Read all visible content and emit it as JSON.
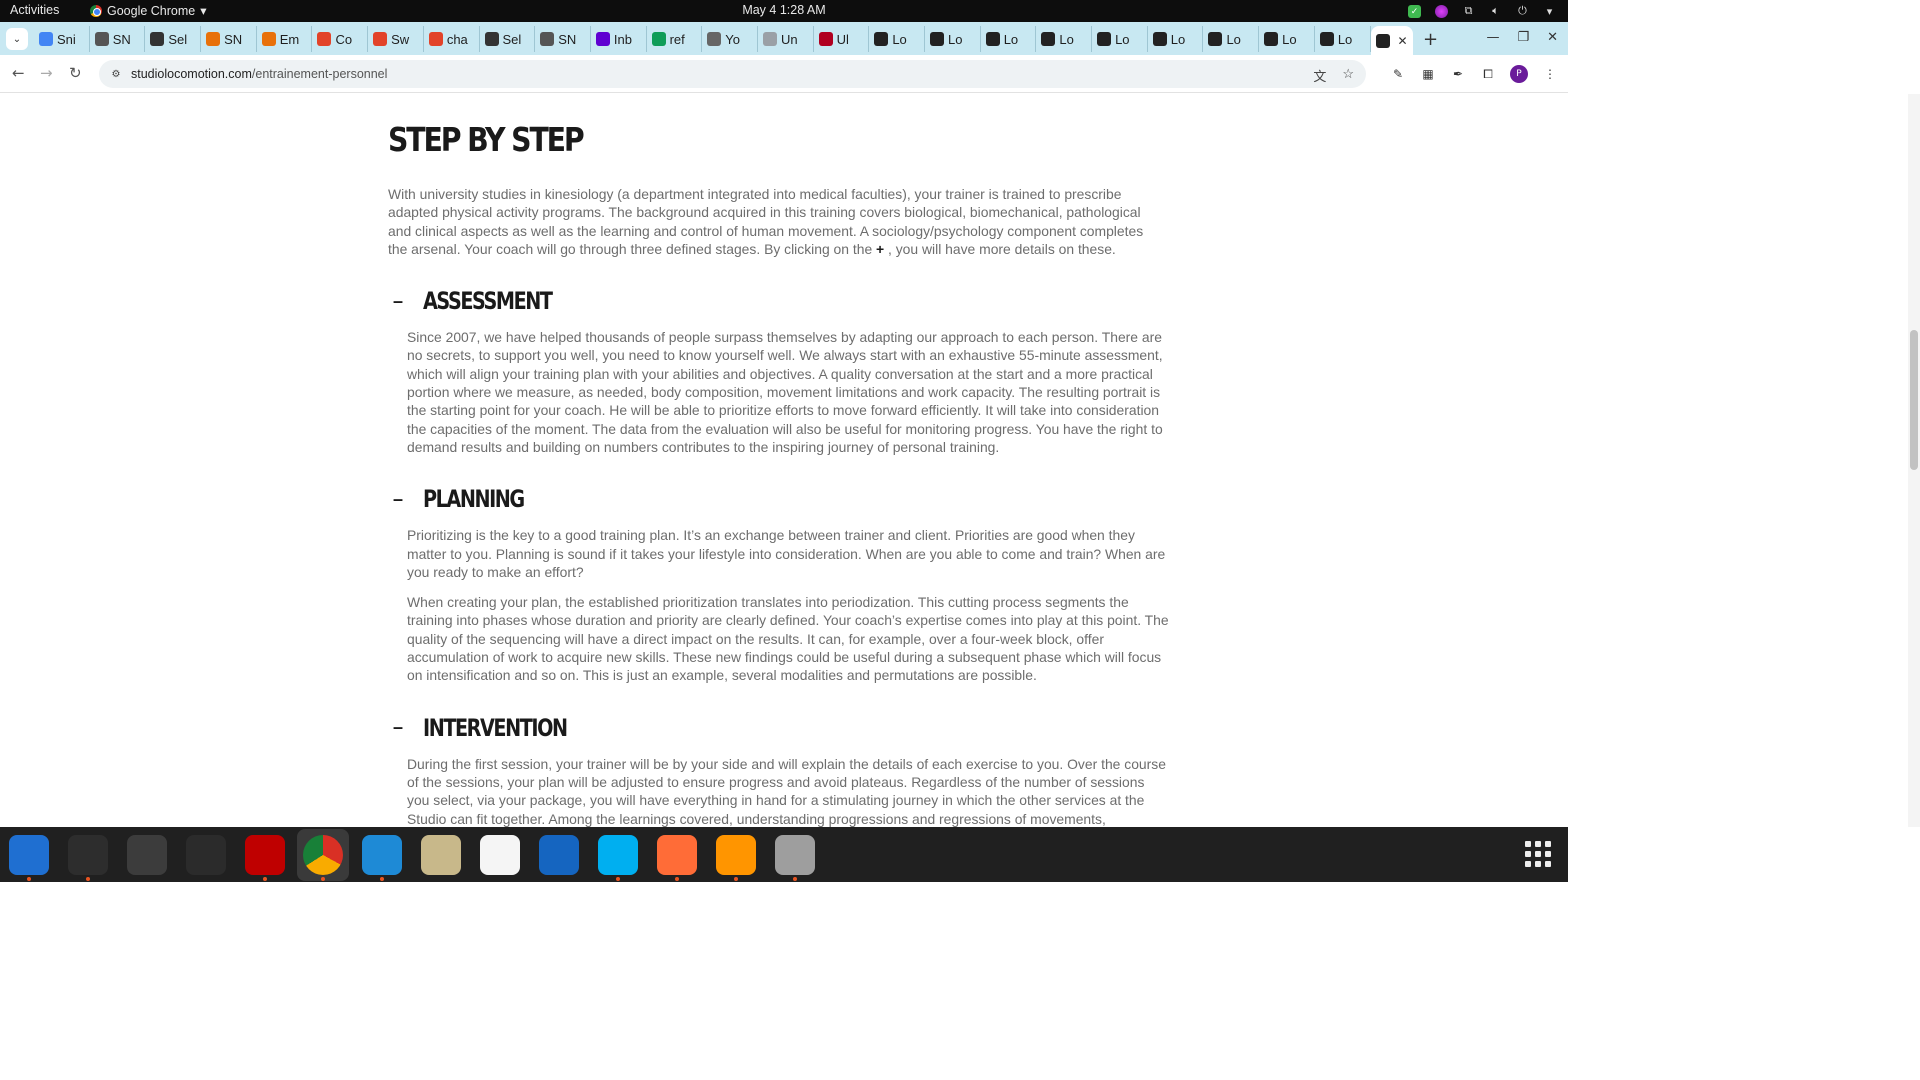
{
  "system": {
    "activities": "Activities",
    "app_name": "Google Chrome",
    "clock": "May 4  1:28 AM"
  },
  "tabs": [
    {
      "label": "Sni",
      "icon": "docs-icon",
      "color": "#4285f4"
    },
    {
      "label": "SN",
      "icon": "snp-icon",
      "color": "#555555"
    },
    {
      "label": "Sel",
      "icon": "circle-icon",
      "color": "#333333"
    },
    {
      "label": "SN",
      "icon": "emoji-icon",
      "color": "#e8710a"
    },
    {
      "label": "Em",
      "icon": "emoji-icon",
      "color": "#e8710a"
    },
    {
      "label": "Co",
      "icon": "gitlab-icon",
      "color": "#e24329"
    },
    {
      "label": "Sw",
      "icon": "gitlab-icon",
      "color": "#e24329"
    },
    {
      "label": "cha",
      "icon": "gitlab-icon",
      "color": "#e24329"
    },
    {
      "label": "Sel",
      "icon": "circle-icon",
      "color": "#333333"
    },
    {
      "label": "SN",
      "icon": "snp-icon",
      "color": "#555555"
    },
    {
      "label": "Inb",
      "icon": "yahoo-icon",
      "color": "#5f01d1"
    },
    {
      "label": "ref",
      "icon": "sheets-icon",
      "color": "#0f9d58"
    },
    {
      "label": "Yo",
      "icon": "spiral-icon",
      "color": "#666666"
    },
    {
      "label": "Un",
      "icon": "page-icon",
      "color": "#9aa0a6"
    },
    {
      "label": "Ul",
      "icon": "flag-icon",
      "color": "#b00020"
    },
    {
      "label": "Lo",
      "icon": "loco-icon",
      "color": "#222222"
    },
    {
      "label": "Lo",
      "icon": "loco-icon",
      "color": "#222222"
    },
    {
      "label": "Lo",
      "icon": "loco-icon",
      "color": "#222222"
    },
    {
      "label": "Lo",
      "icon": "loco-icon",
      "color": "#222222"
    },
    {
      "label": "Lo",
      "icon": "loco-icon",
      "color": "#222222"
    },
    {
      "label": "Lo",
      "icon": "loco-icon",
      "color": "#222222"
    },
    {
      "label": "Lo",
      "icon": "loco-icon",
      "color": "#222222"
    },
    {
      "label": "Lo",
      "icon": "loco-icon",
      "color": "#222222"
    },
    {
      "label": "Lo",
      "icon": "loco-icon",
      "color": "#222222"
    }
  ],
  "address": {
    "host": "studiolocomotion.com",
    "path": "/entrainement-personnel"
  },
  "page": {
    "title": "STEP BY STEP",
    "intro": "With university studies in kinesiology (a department integrated into medical faculties), your trainer is trained to prescribe adapted physical activity programs. The background acquired in this training covers biological, biomechanical, pathological and clinical aspects as well as the learning and control of human movement. A sociology/psychology component completes the arsenal. Your coach will go through three defined stages. By clicking on the",
    "intro_plus": "+",
    "intro_end": ", you will have more details on these.",
    "sections": [
      {
        "toggle": "–",
        "title": "ASSESSMENT",
        "paragraphs": [
          "Since 2007, we have helped thousands of people surpass themselves by adapting our approach to each person. There are no secrets, to support you well, you need to know yourself well. We always start with an exhaustive 55-minute assessment, which will align your training plan with your abilities and objectives. A quality conversation at the start and a more practical portion where we measure, as needed, body composition, movement limitations and work capacity. The resulting portrait is the starting point for your coach. He will be able to prioritize efforts to move forward efficiently. It will take into consideration the capacities of the moment. The data from the evaluation will also be useful for monitoring progress. You have the right to demand results and building on numbers contributes to the inspiring journey of personal training."
        ]
      },
      {
        "toggle": "–",
        "title": "PLANNING",
        "paragraphs": [
          "Prioritizing is the key to a good training plan. It’s an exchange between trainer and client. Priorities are good when they matter to you. Planning is sound if it takes your lifestyle into consideration. When are you able to come and train? When are you ready to make an effort?",
          "When creating your plan, the established prioritization translates into periodization. This cutting process segments the training into phases whose duration and priority are clearly defined. Your coach’s expertise comes into play at this point. The quality of the sequencing will have a direct impact on the results. It can, for example, over a four-week block, offer accumulation of work to acquire new skills. These new findings could be useful during a subsequent phase which will focus on intensification and so on. This is just an example, several modalities and permutations are possible."
        ]
      },
      {
        "toggle": "–",
        "title": "INTERVENTION",
        "paragraphs": [
          "During the first session, your trainer will be by your side and will explain the details of each exercise to you. Over the course of the sessions, your plan will be adjusted to ensure progress and avoid plateaus. Regardless of the number of sessions you select, via your package, you will have everything in hand for a stimulating journey in which the other services at the Studio can fit together. Among the learnings covered, understanding progressions and regressions of movements, managing the risk of injuries and"
        ]
      }
    ]
  },
  "dock": [
    {
      "name": "thunderbird-icon",
      "color": "#1f6fd1"
    },
    {
      "name": "terminal-icon",
      "color": "#2d2d2d"
    },
    {
      "name": "calculator-icon",
      "color": "#3c3c3c"
    },
    {
      "name": "system-monitor-icon",
      "color": "#2b2b2b"
    },
    {
      "name": "filezilla-icon",
      "color": "#bf0000"
    },
    {
      "name": "chrome-icon",
      "color": "#ffffff"
    },
    {
      "name": "vscode-icon",
      "color": "#1e8ad6"
    },
    {
      "name": "files-icon",
      "color": "#c8b88a"
    },
    {
      "name": "text-editor-icon",
      "color": "#f5f5f5"
    },
    {
      "name": "writer-icon",
      "color": "#1565c0"
    },
    {
      "name": "skype-icon",
      "color": "#00aff0"
    },
    {
      "name": "postman-icon",
      "color": "#ff6c37"
    },
    {
      "name": "firefox-dev-icon",
      "color": "#ff9500"
    },
    {
      "name": "disk-icon",
      "color": "#9e9e9e"
    }
  ]
}
